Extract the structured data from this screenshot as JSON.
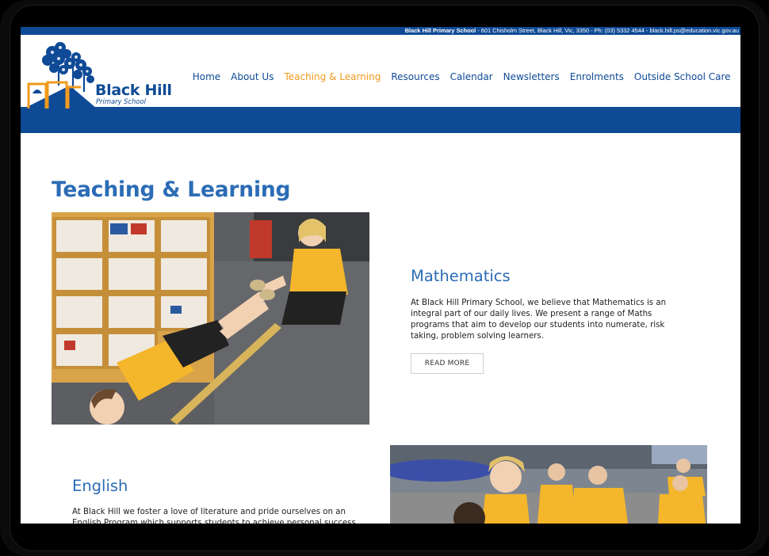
{
  "topbar": {
    "school_name": "Black Hill Primary School",
    "details": " - 601 Chisholm Street, Black Hill, Vic, 3350 - Ph: (03) 5332 4544 - black.hill.ps@education.vic.gov.au"
  },
  "logo": {
    "name": "Black Hill",
    "subtitle": "Primary School"
  },
  "nav": {
    "items": [
      {
        "label": "Home"
      },
      {
        "label": "About Us"
      },
      {
        "label": "Teaching & Learning",
        "active": true
      },
      {
        "label": "Resources"
      },
      {
        "label": "Calendar"
      },
      {
        "label": "Newsletters"
      },
      {
        "label": "Enrolments"
      },
      {
        "label": "Outside School Care"
      }
    ]
  },
  "page": {
    "title": "Teaching & Learning"
  },
  "sections": {
    "mathematics": {
      "heading": "Mathematics",
      "body": "At Black Hill Primary School, we believe that Mathematics is an integral part of our daily lives. We present a range of Maths programs that aim to develop our students into numerate, risk taking, problem solving learners.",
      "button": "READ MORE"
    },
    "english": {
      "heading": "English",
      "body": "At Black Hill we foster a love of literature and pride ourselves on an English Program which supports students to achieve personal success"
    }
  },
  "colors": {
    "brand_blue": "#0e4a96",
    "heading_blue": "#2b6cb5",
    "accent_orange": "#f19a1c"
  }
}
